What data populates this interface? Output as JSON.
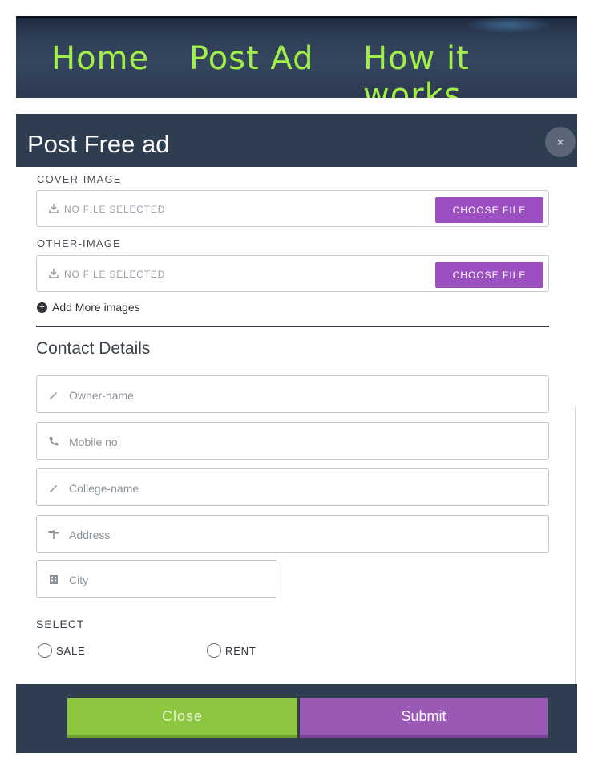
{
  "nav": {
    "home": "Home",
    "post_ad": "Post Ad",
    "how_it_works": "How it works",
    "text_color": "#a3ef4a"
  },
  "modal": {
    "title": "Post Free ad",
    "close_symbol": "×",
    "cover_image": {
      "label": "COVER-IMAGE",
      "status": "NO FILE SELECTED",
      "button": "CHOOSE FILE",
      "icon": "download-icon"
    },
    "other_image": {
      "label": "OTHER-IMAGE",
      "status": "NO FILE SELECTED",
      "button": "CHOOSE FILE",
      "icon": "download-icon"
    },
    "add_more": {
      "symbol": "+",
      "label": "Add More images",
      "icon": "plus-circle-icon"
    },
    "contact": {
      "title": "Contact Details",
      "fields": {
        "owner": {
          "placeholder": "Owner-name",
          "icon": "pencil-icon"
        },
        "mobile": {
          "placeholder": "Mobile no.",
          "icon": "phone-icon"
        },
        "college": {
          "placeholder": "College-name",
          "icon": "pencil-icon"
        },
        "address": {
          "placeholder": "Address",
          "icon": "signpost-icon"
        },
        "city": {
          "placeholder": "City",
          "icon": "building-icon"
        }
      }
    },
    "select": {
      "label": "SELECT",
      "options": {
        "sale": "SALE",
        "rent": "RENT"
      }
    },
    "footer": {
      "close": "Close",
      "submit": "Submit"
    },
    "colors": {
      "header_bg": "#2f3d51",
      "choose_button": "#9b4fc0",
      "close_button": "#8dc63f",
      "submit_button": "#9b59b6"
    }
  }
}
